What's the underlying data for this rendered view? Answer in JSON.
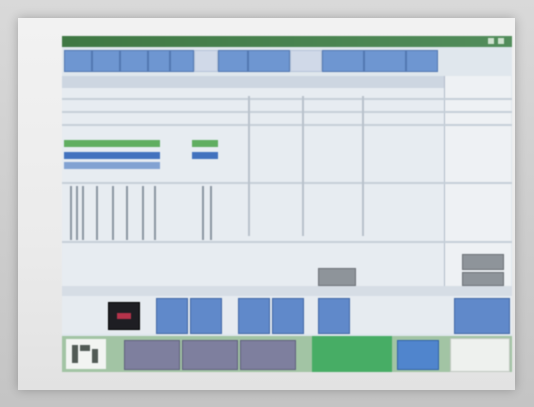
{
  "app": {
    "title": ""
  },
  "tabs": [
    {
      "label": ""
    },
    {
      "label": ""
    },
    {
      "label": ""
    },
    {
      "label": ""
    },
    {
      "label": ""
    },
    {
      "label": ""
    },
    {
      "label": ""
    },
    {
      "label": ""
    },
    {
      "label": ""
    },
    {
      "label": ""
    },
    {
      "label": ""
    }
  ],
  "toolbar": {
    "buttons": [
      {
        "label": ""
      },
      {
        "label": ""
      },
      {
        "label": ""
      },
      {
        "label": ""
      },
      {
        "label": ""
      },
      {
        "label": ""
      }
    ],
    "record_button": {
      "label": ""
    }
  },
  "dock": {
    "buttons": [
      {
        "label": ""
      },
      {
        "label": ""
      },
      {
        "label": ""
      }
    ],
    "ok_button": {
      "label": ""
    },
    "logo_icon": "logo-icon"
  },
  "colors": {
    "titlebar": "#3a7a3f",
    "tab_active": "#6a96d8",
    "button_blue": "#5c89d2",
    "dock_green": "#3fb060",
    "record_red": "#c0304a"
  }
}
